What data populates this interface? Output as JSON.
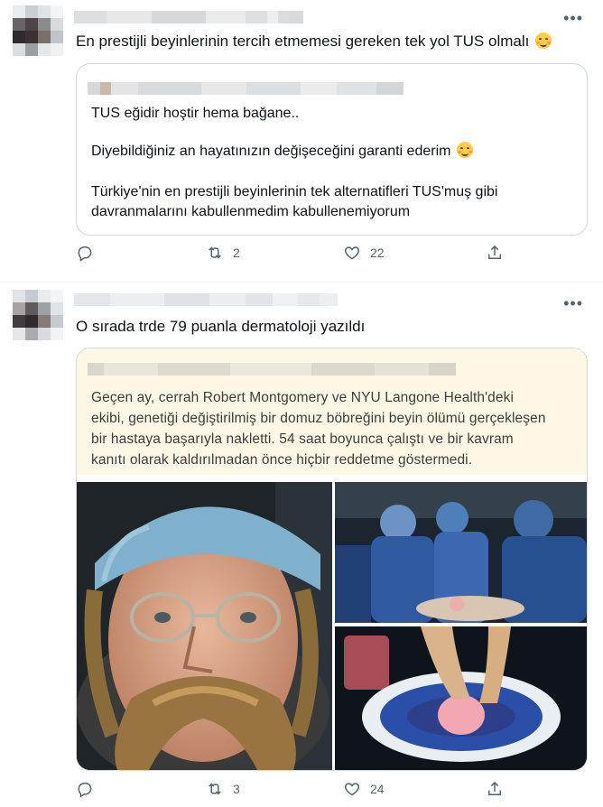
{
  "tweets": [
    {
      "text": "En prestijli beyinlerinin tercih etmemesi gereken tek yol TUS olmalı",
      "quote": {
        "line1": "TUS eğidir hoştir hema bağane..",
        "line2": "Diyebildiğiniz an hayatınızın değişeceğini garanti ederim",
        "line3": "Türkiye'nin en prestijli beyinlerinin tek alternatifleri TUS'muş gibi",
        "line4": "davranmalarını kabullenmedim kabullenemiyorum"
      },
      "retweets": "2",
      "likes": "22"
    },
    {
      "text": "O sırada trde 79 puanla dermatoloji yazıldı",
      "quote": {
        "news_lines": [
          "Geçen ay, cerrah Robert Montgomery ve NYU Langone Health'deki",
          "ekibi, genetiği değiştirilmiş bir domuz böbreğini beyin ölümü gerçekleşen",
          "bir hastaya başarıyla nakletti. 54 saat boyunca çalıştı ve bir kavram",
          "kanıtı olarak kaldırılmadan önce hiçbir reddetme göstermedi."
        ]
      },
      "retweets": "3",
      "likes": "24"
    }
  ],
  "icons": {
    "more": "more-icon",
    "reply": "reply-icon",
    "retweet": "retweet-icon",
    "like": "heart-icon",
    "share": "share-icon",
    "emoji": "smiling-face-emoji"
  },
  "colors": {
    "icon": "#536471",
    "border": "#cfd9de",
    "news_bg": "#fdf8e5"
  }
}
